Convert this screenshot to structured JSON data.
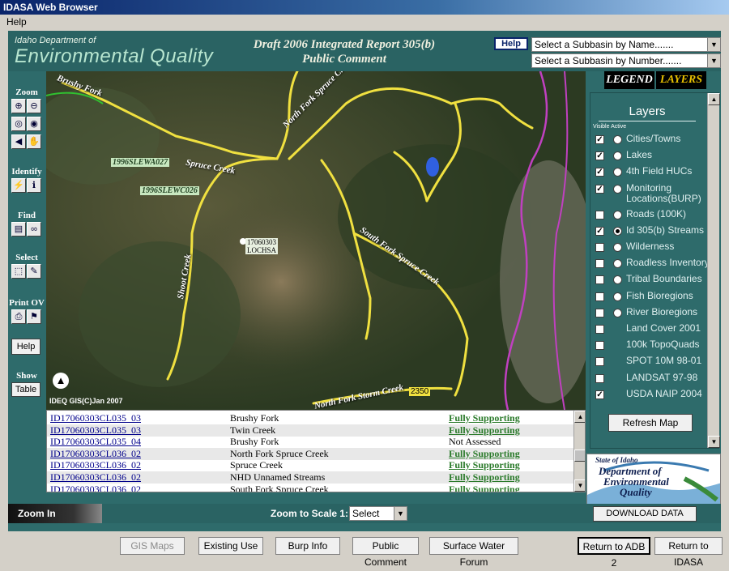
{
  "window": {
    "title": "IDASA Web Browser"
  },
  "menu": {
    "help": "Help"
  },
  "header": {
    "agency_line1": "Idaho Department of",
    "agency_line2": "Environmental Quality",
    "report_title_line1": "Draft 2006 Integrated Report 305(b)",
    "report_title_line2": "Public Comment",
    "help_button": "Help",
    "subbasin_by_name": "Select a Subbasin by Name.......",
    "subbasin_by_number": "Select a Subbasin by Number......."
  },
  "toolbar": {
    "zoom_label": "Zoom",
    "identify_label": "Identify",
    "find_label": "Find",
    "select_label": "Select",
    "print_label": "Print OV",
    "help_button": "Help",
    "show_label": "Show",
    "table_button": "Table"
  },
  "map": {
    "labels": {
      "brushy_fork": "Brushy Fork",
      "site_a027": "1996SLEWA027",
      "spruce_creek": "Spruce Creek",
      "nf_spruce": "North Fork Spruce Creek",
      "site_c026": "1996SLEWC026",
      "shoot_creek": "Shoot Creek",
      "huc_code": "17060303",
      "huc_name": "LOCHSA",
      "sf_spruce": "South Fork Spruce Creek",
      "nf_storm": "North Fork Storm Creek",
      "scale_num": "2350",
      "credit": "IDEQ GIS(C)Jan 2007"
    },
    "colors": {
      "stream": "#f0e040",
      "boundary": "#c040c0",
      "lake": "#3060e0"
    }
  },
  "table": {
    "rows": [
      {
        "id": "ID17060303CL035_03",
        "name": "Brushy Fork",
        "status": "Fully Supporting"
      },
      {
        "id": "ID17060303CL035_03",
        "name": "Twin Creek",
        "status": "Fully Supporting"
      },
      {
        "id": "ID17060303CL035_04",
        "name": "Brushy Fork",
        "status": "Not Assessed"
      },
      {
        "id": "ID17060303CL036_02",
        "name": "North Fork Spruce Creek",
        "status": "Fully Supporting"
      },
      {
        "id": "ID17060303CL036_02",
        "name": "Spruce Creek",
        "status": "Fully Supporting"
      },
      {
        "id": "ID17060303CL036_02",
        "name": "NHD Unnamed Streams",
        "status": "Fully Supporting"
      },
      {
        "id": "ID17060303CL036_02",
        "name": "South Fork Spruce Creek",
        "status": "Fully Supporting"
      }
    ]
  },
  "panel": {
    "tab_legend": "LEGEND",
    "tab_layers": "LAYERS",
    "layers_title": "Layers",
    "col_visible": "Visible",
    "col_active": "Active",
    "layers": [
      {
        "label": "Cities/Towns",
        "visible": true,
        "active": false,
        "has_radio": true
      },
      {
        "label": "Lakes",
        "visible": true,
        "active": false,
        "has_radio": true
      },
      {
        "label": "4th Field HUCs",
        "visible": true,
        "active": false,
        "has_radio": true
      },
      {
        "label": "Monitoring Locations(BURP)",
        "visible": true,
        "active": false,
        "has_radio": true
      },
      {
        "label": "Roads (100K)",
        "visible": false,
        "active": false,
        "has_radio": true
      },
      {
        "label": "Id 305(b) Streams",
        "visible": true,
        "active": true,
        "has_radio": true
      },
      {
        "label": "Wilderness",
        "visible": false,
        "active": false,
        "has_radio": true
      },
      {
        "label": "Roadless Inventory",
        "visible": false,
        "active": false,
        "has_radio": true
      },
      {
        "label": "Tribal Boundaries",
        "visible": false,
        "active": false,
        "has_radio": true
      },
      {
        "label": "Fish Bioregions",
        "visible": false,
        "active": false,
        "has_radio": true
      },
      {
        "label": "River Bioregions",
        "visible": false,
        "active": false,
        "has_radio": true
      },
      {
        "label": "Land Cover 2001",
        "visible": false,
        "active": false,
        "has_radio": false
      },
      {
        "label": "100k TopoQuads",
        "visible": false,
        "active": false,
        "has_radio": false
      },
      {
        "label": "SPOT 10M 98-01",
        "visible": false,
        "active": false,
        "has_radio": false
      },
      {
        "label": "LANDSAT 97-98",
        "visible": false,
        "active": false,
        "has_radio": false
      },
      {
        "label": "USDA NAIP 2004",
        "visible": true,
        "active": false,
        "has_radio": false
      }
    ],
    "refresh_button": "Refresh Map",
    "logo_line1": "State of Idaho",
    "logo_line2": "Department of",
    "logo_line3": "Environmental",
    "logo_line4": "Quality"
  },
  "bottom": {
    "zoom_status": "Zoom In",
    "zoom_scale_label": "Zoom to Scale 1:",
    "scale_select": "Select",
    "download_button": "DOWNLOAD DATA",
    "buttons": {
      "gis_maps": "GIS Maps",
      "existing_use": "Existing Use",
      "burp_info": "Burp Info",
      "public_comment": "Public Comment",
      "surface_water": "Surface Water Forum",
      "return_adb": "Return to ADB 2",
      "return_idasa": "Return to IDASA"
    }
  }
}
